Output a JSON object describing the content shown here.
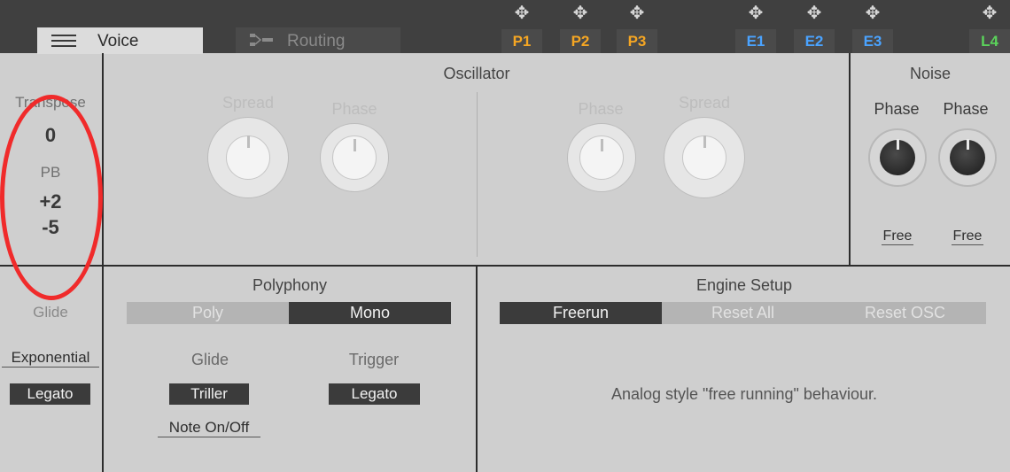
{
  "tabs": {
    "voice_label": "Voice",
    "routing_label": "Routing"
  },
  "macros": [
    {
      "label": "P1",
      "color": "#f5a623"
    },
    {
      "label": "P2",
      "color": "#f5a623"
    },
    {
      "label": "P3",
      "color": "#f5a623"
    },
    {
      "label": "E1",
      "color": "#4aa3ff"
    },
    {
      "label": "E2",
      "color": "#4aa3ff"
    },
    {
      "label": "E3",
      "color": "#4aa3ff"
    },
    {
      "label": "L4",
      "color": "#5bd35b"
    }
  ],
  "move_glyph": "✥",
  "left": {
    "transpose_label": "Transpose",
    "transpose_value": "0",
    "pb_label": "PB",
    "pb_up": "+2",
    "pb_down": "-5",
    "glide_label": "Glide",
    "glide_mode": "Exponential",
    "glide_trigger": "Legato"
  },
  "oscillator": {
    "title": "Oscillator",
    "knobs": [
      "Spread",
      "Phase",
      "Phase",
      "Spread"
    ]
  },
  "noise": {
    "title": "Noise",
    "knob1_label": "Phase",
    "knob2_label": "Phase",
    "mode1": "Free",
    "mode2": "Free"
  },
  "polyphony": {
    "title": "Polyphony",
    "poly_label": "Poly",
    "mono_label": "Mono",
    "selected": "Mono",
    "glide_label": "Glide",
    "trigger_label": "Trigger",
    "glide_value": "Triller",
    "trigger_value": "Legato",
    "note_mode": "Note On/Off"
  },
  "engine_setup": {
    "title": "Engine Setup",
    "options": [
      "Freerun",
      "Reset All",
      "Reset OSC"
    ],
    "selected": "Freerun",
    "description": "Analog style \"free running\" behaviour."
  },
  "annotation_color": "#f02b2b"
}
